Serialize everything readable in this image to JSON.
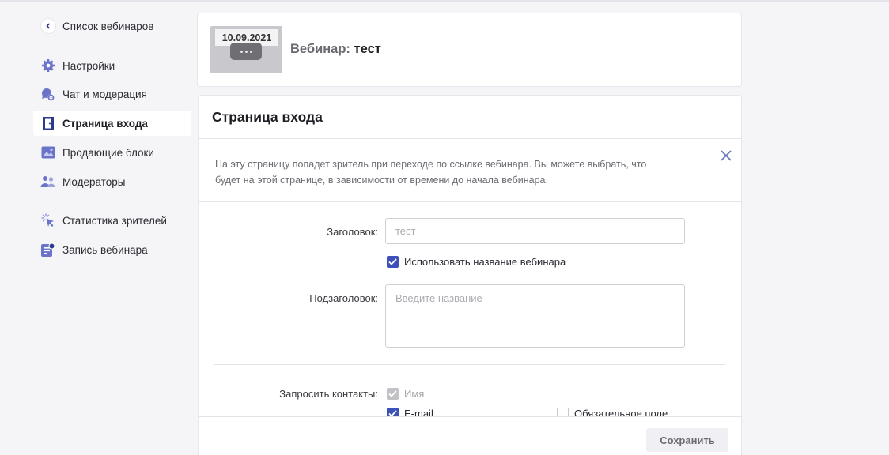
{
  "sidebar": {
    "back_label": "Список вебинаров",
    "items": [
      {
        "label": "Настройки",
        "icon": "gear-icon"
      },
      {
        "label": "Чат и модерация",
        "icon": "chat-settings-icon"
      },
      {
        "label": "Страница входа",
        "icon": "door-icon",
        "active": true
      },
      {
        "label": "Продающие блоки",
        "icon": "image-icon"
      },
      {
        "label": "Модераторы",
        "icon": "moderators-icon"
      },
      {
        "label": "Статистика зрителей",
        "icon": "cursor-click-icon"
      },
      {
        "label": "Запись вебинара",
        "icon": "record-icon"
      }
    ]
  },
  "header": {
    "thumb_date": "10.09.2021",
    "title_prefix": "Вебинар:",
    "title_value": "тест"
  },
  "main": {
    "title": "Страница входа",
    "info_line1": "На эту страницу попадет зритель при переходе по ссылке вебинара. Вы можете выбрать, что",
    "info_line2": "будет на этой странице, в зависимости от времени до начала вебинара.",
    "heading_label": "Заголовок:",
    "heading_placeholder": "тест",
    "use_webinar_name_label": "Использовать название вебинара",
    "use_webinar_name_checked": true,
    "subheading_label": "Подзаголовок:",
    "subheading_placeholder": "Введите название",
    "request_contacts_label": "Запросить контакты:",
    "contact_name_label": "Имя",
    "contact_email_label": "E-mail",
    "required_field_label": "Обязательное поле",
    "save_label": "Сохранить"
  },
  "colors": {
    "accent": "#3d52b8",
    "sidebar_icon": "#6b74c9",
    "page_bg": "#f5f5f7"
  }
}
